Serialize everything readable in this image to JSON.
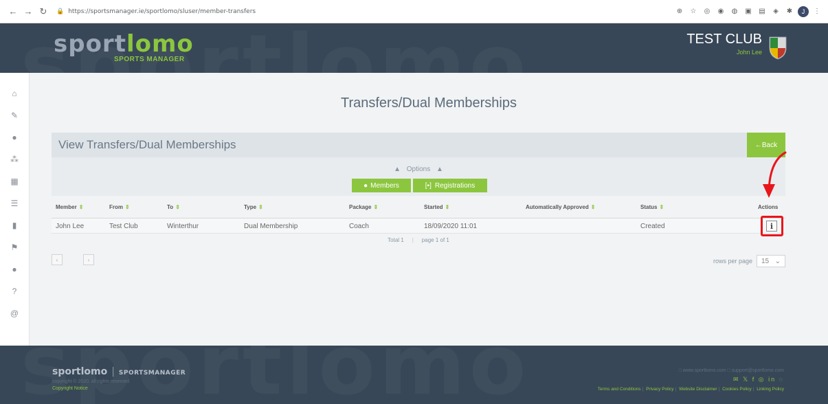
{
  "browser": {
    "url": "https://sportsmanager.ie/sportlomo/sluser/member-transfers",
    "back_icon": "arrow-left-icon",
    "forward_icon": "arrow-right-icon",
    "reload_icon": "reload-icon",
    "avatar_letter": "J"
  },
  "header": {
    "brand_part1": "sport",
    "brand_part2": "lomo",
    "brand_sub": "SPORTS MANAGER",
    "club_name": "TEST CLUB",
    "user_name": "John Lee",
    "watermark": "sportlomo"
  },
  "sidebar": {
    "items": [
      {
        "icon": "home-icon",
        "glyph": "⌂"
      },
      {
        "icon": "edit-icon",
        "glyph": "✎"
      },
      {
        "icon": "user-icon",
        "glyph": "●"
      },
      {
        "icon": "users-icon",
        "glyph": "⁂"
      },
      {
        "icon": "calendar-icon",
        "glyph": "▦"
      },
      {
        "icon": "list-icon",
        "glyph": "☰"
      },
      {
        "icon": "trash-icon",
        "glyph": "▮"
      },
      {
        "icon": "flag-icon",
        "glyph": "⚑"
      },
      {
        "icon": "person-icon",
        "glyph": "●"
      },
      {
        "icon": "help-icon",
        "glyph": "?"
      },
      {
        "icon": "at-icon",
        "glyph": "@"
      }
    ]
  },
  "page": {
    "title": "Transfers/Dual Memberships",
    "panel_title": "View Transfers/Dual Memberships",
    "back_label": "←Back",
    "options_label": "Options",
    "members_label": "Members",
    "registrations_label": "Registrations"
  },
  "table": {
    "headers": [
      "Member",
      "From",
      "To",
      "Type",
      "Package",
      "Started",
      "Automatically Approved",
      "Status",
      "Actions"
    ],
    "rows": [
      {
        "member": "John Lee",
        "from": "Test Club",
        "to": "Winterthur",
        "type": "Dual Membership",
        "package": "Coach",
        "started": "18/09/2020 11:01",
        "auto_approved": "",
        "status": "Created"
      }
    ],
    "total_label": "Total 1",
    "page_label": "page 1 of 1",
    "rows_per_page_label": "rows per page",
    "rows_per_page_value": "15"
  },
  "footer": {
    "brand": "sportlomo",
    "brand_sub": "SPORTSMANAGER",
    "copyright": "copyright © 2020. all rights reserved",
    "notice": "Copyright Notice",
    "contact": "□ www.sportlomo.com  □ support@sportlomo.com",
    "social": "✉ 𝕏 f ◎ in ◌",
    "links": [
      "Terms and Conditions",
      "Privacy Policy",
      "Website Disclaimer",
      "Cookies Policy",
      "Linking Policy"
    ]
  },
  "colors": {
    "accent": "#8cc63f",
    "header_bg": "#384757",
    "highlight": "#e8161a"
  }
}
